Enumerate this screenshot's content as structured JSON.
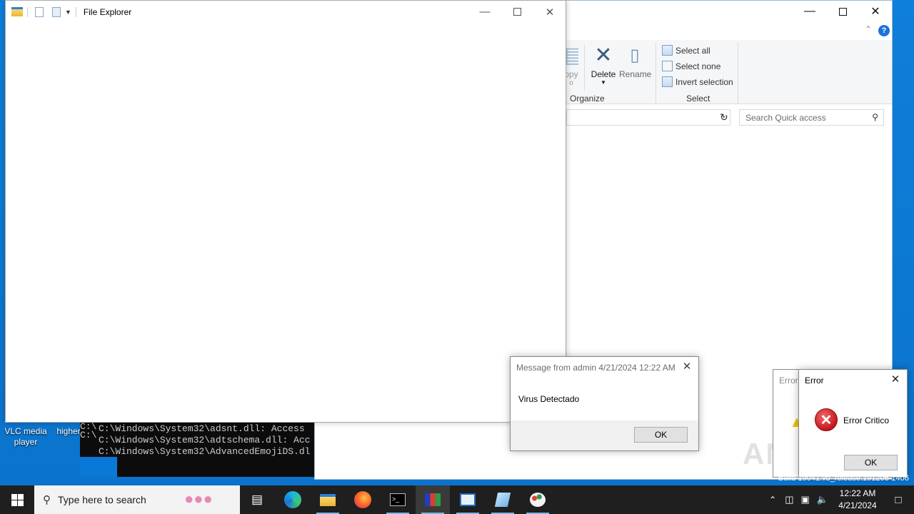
{
  "foreground_window": {
    "title": "File Explorer"
  },
  "background_window": {
    "ribbon": {
      "copy_label_partial": "opy",
      "copy_label_partial2": "o",
      "delete_label": "Delete",
      "rename_label": "Rename",
      "organize_label": "Organize",
      "select_all_label": "Select all",
      "select_none_label": "Select none",
      "invert_selection_label": "Invert selection",
      "select_group_label": "Select"
    },
    "search_placeholder": "Search Quick access"
  },
  "desktop_icons": [
    {
      "label": "VLC media player"
    },
    {
      "label": "higher"
    }
  ],
  "console": {
    "lines": [
      "C:\\Windows\\System32\\adsnt.dll: Access",
      "C:\\Windows\\System32\\adtschema.dll: Acc",
      "C:\\Windows\\System32\\AdvancedEmojiDS.dl"
    ],
    "partial_prefix": "C:\\"
  },
  "message_dialog": {
    "title": "Message from admin 4/21/2024 12:22 AM",
    "body": "Virus Detectado",
    "ok_label": "OK"
  },
  "error_dialog_back": {
    "title_partial": "Error"
  },
  "error_dialog": {
    "title": "Error",
    "message": "Error Critico",
    "ok_label": "OK"
  },
  "watermark": "ANY RUN",
  "build_text": "Build 19041.vb_release.191206-1406",
  "taskbar": {
    "search_placeholder": "Type here to search",
    "time": "12:22 AM",
    "date": "4/21/2024"
  },
  "colors": {
    "desktop": "#0b73cc",
    "taskbar": "#1f1f1f",
    "accent": "#76b9ed",
    "error_red": "#c4161c"
  }
}
